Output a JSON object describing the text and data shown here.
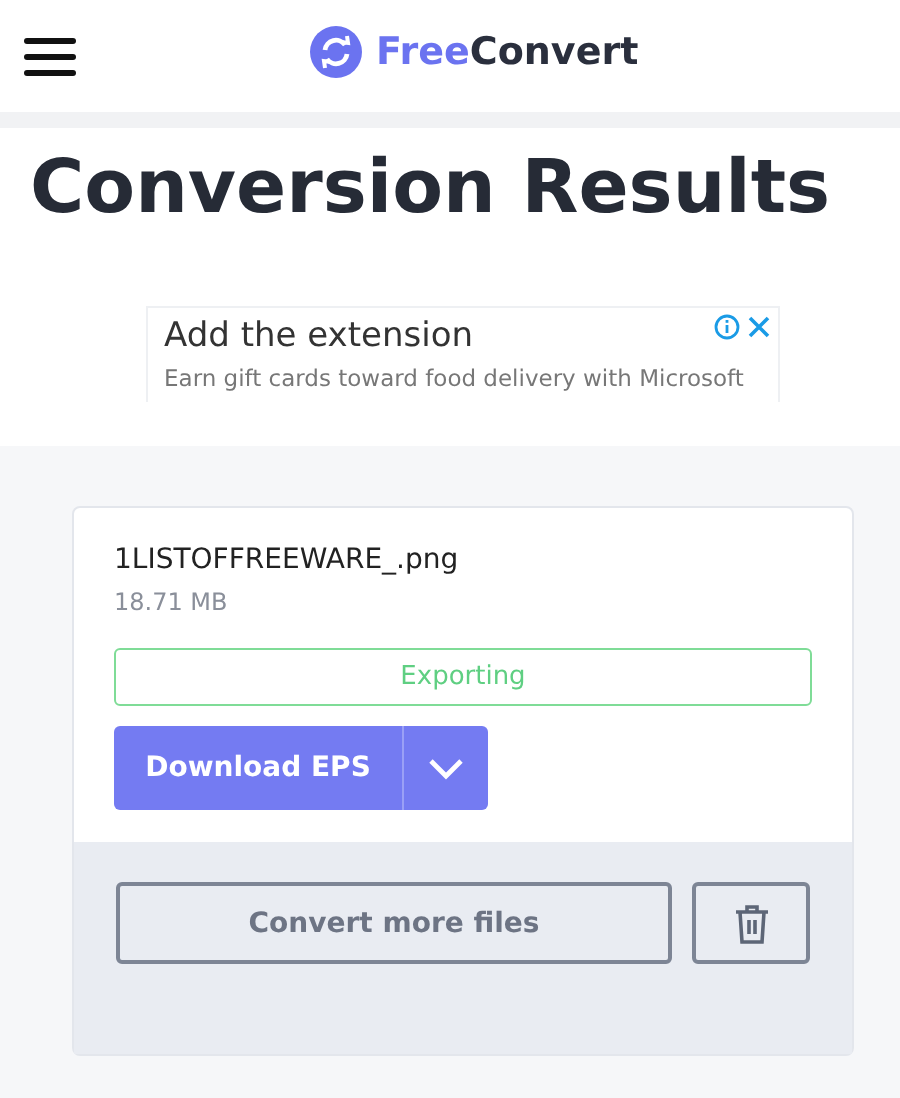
{
  "header": {
    "logo": {
      "accent": "Free",
      "rest": "Convert"
    }
  },
  "title": "Conversion Results",
  "ad": {
    "headline": "Add the extension",
    "text": "Earn gift cards toward food delivery with Microsoft"
  },
  "file": {
    "name": "1LISTOFFREEWARE_.png",
    "size": "18.71 MB",
    "status": "Exporting",
    "download_label": "Download EPS"
  },
  "actions": {
    "convert_more": "Convert more files"
  }
}
